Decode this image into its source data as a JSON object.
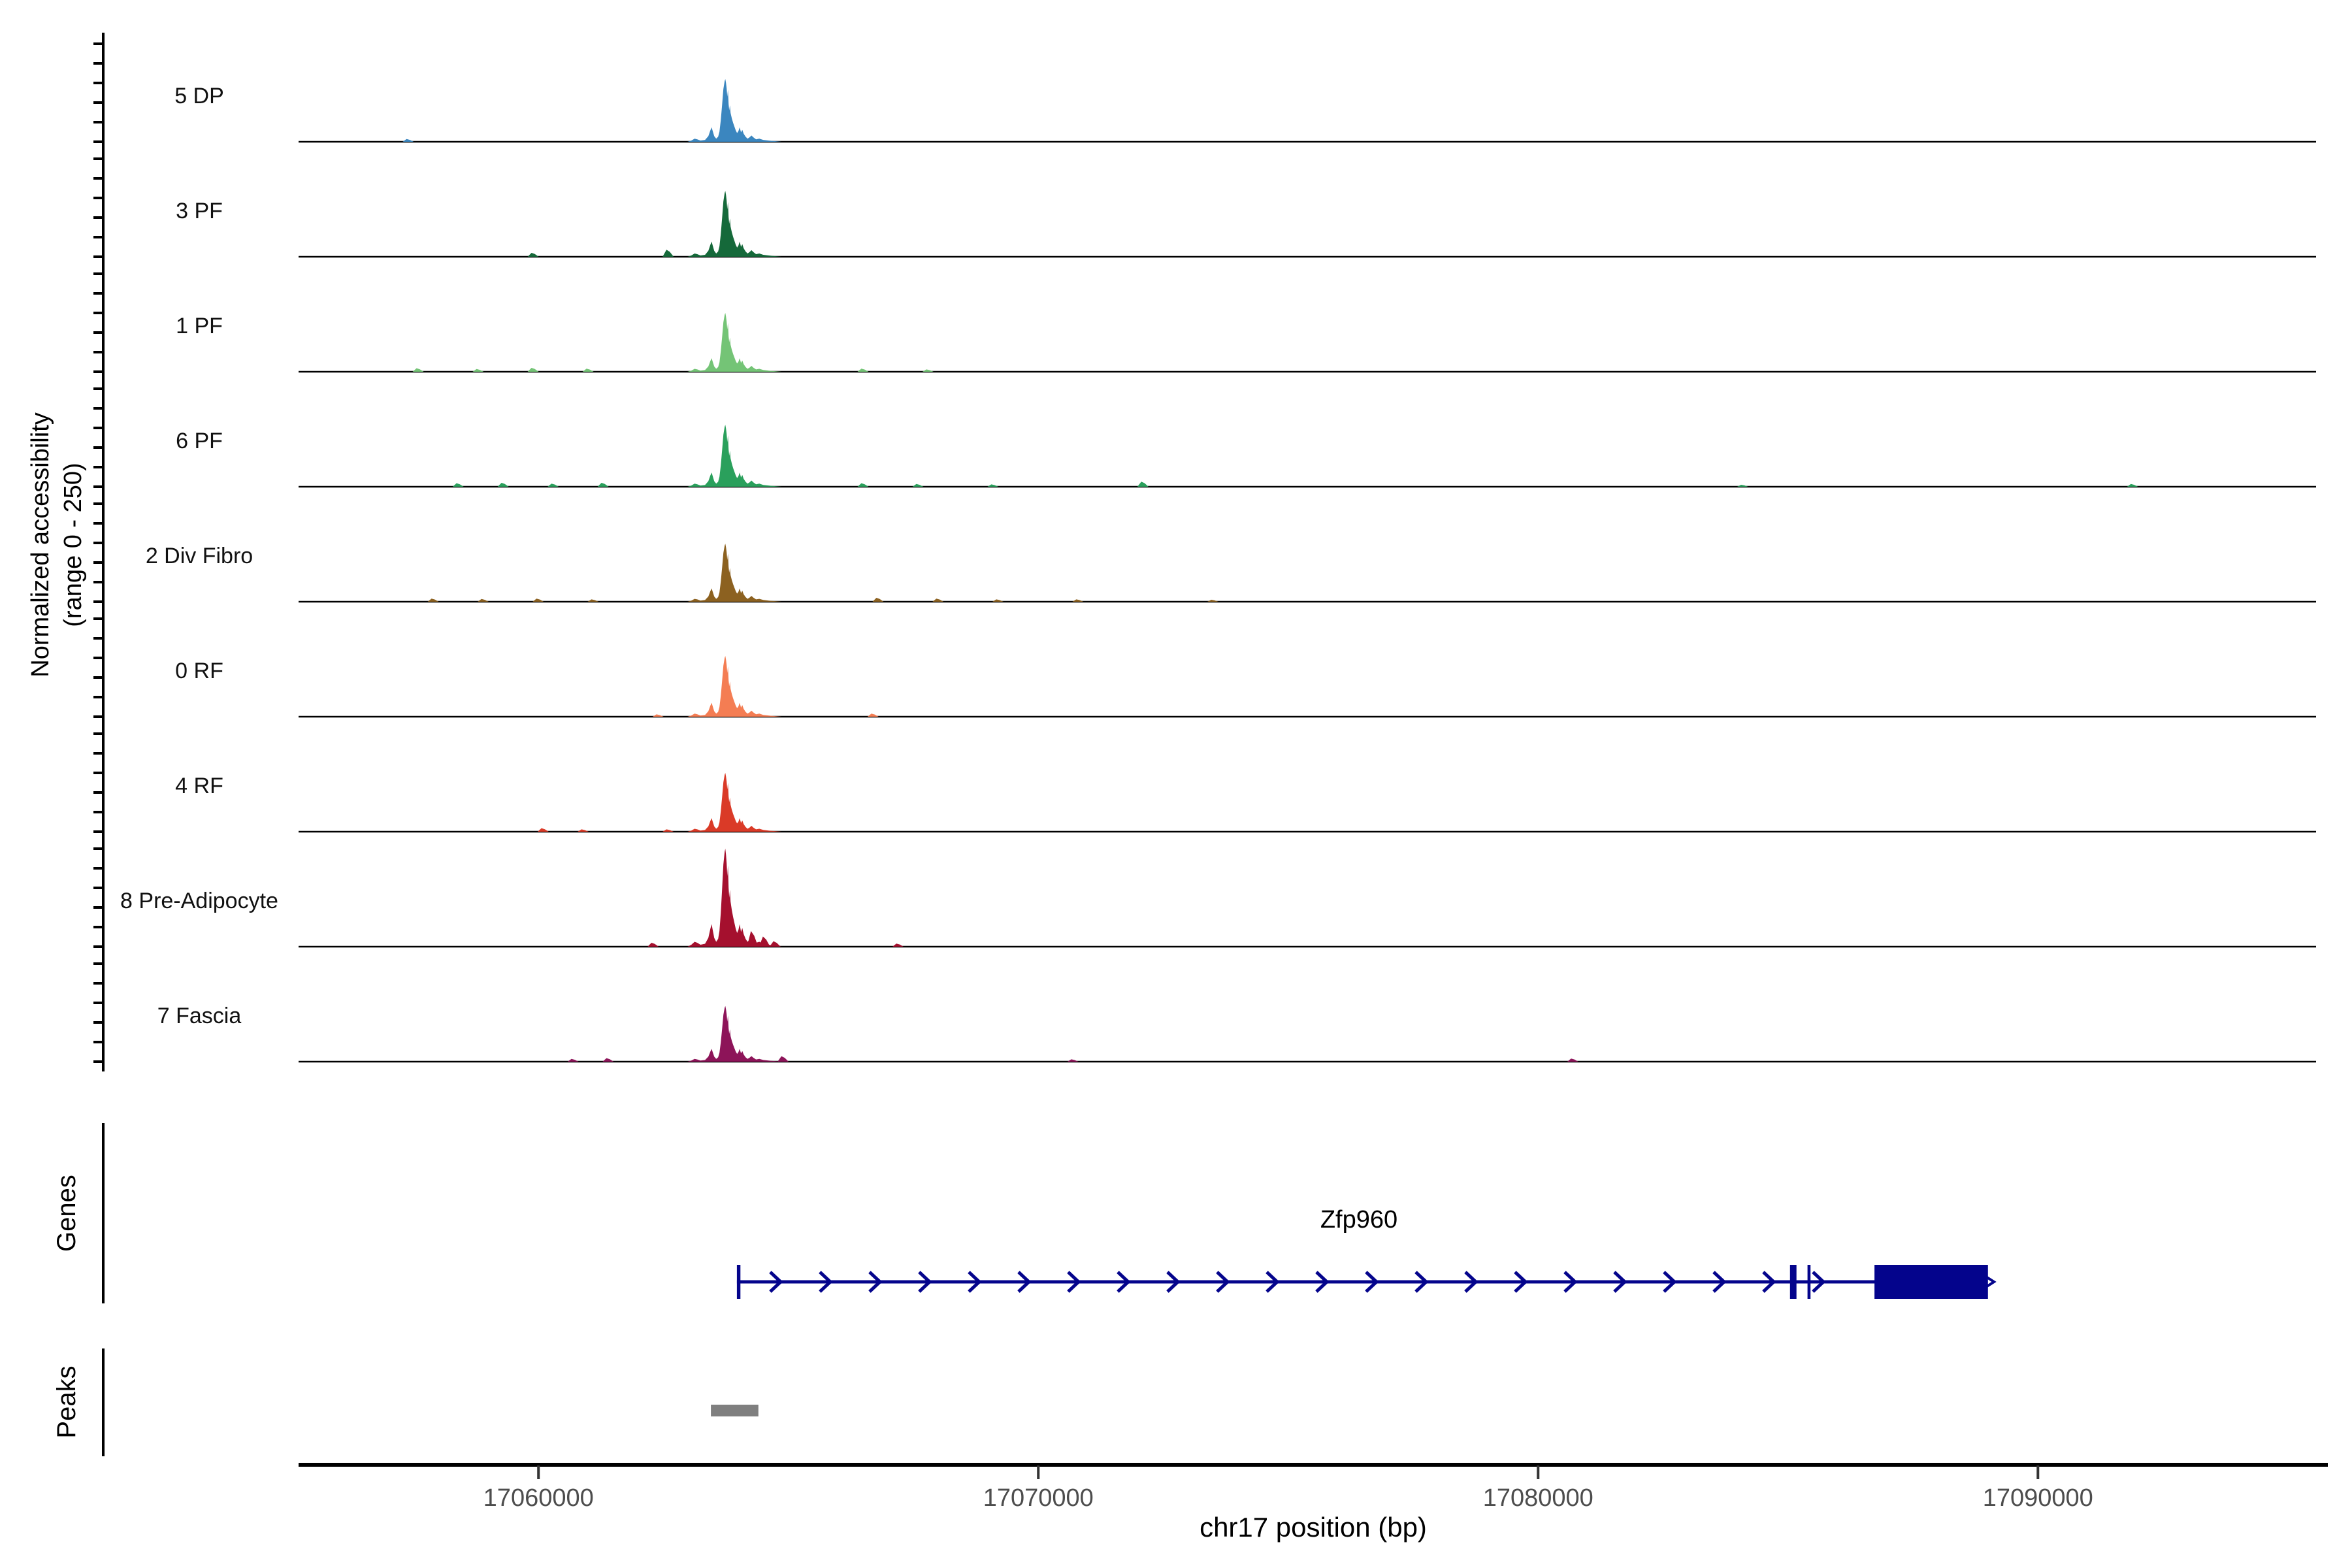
{
  "figure": {
    "y_axis_title": {
      "line1": "Normalized accessibility",
      "line2": "(range 0 - 250)"
    },
    "x_axis_title": "chr17 position (bp)",
    "sections": {
      "genes_label": "Genes",
      "peaks_label": "Peaks"
    },
    "gene_label": "Zfp960"
  },
  "chart_data": {
    "type": "area",
    "title": "",
    "description": "Genome-browser style normalized chromatin accessibility coverage tracks at the Zfp960 locus, with gene model and called peak",
    "region": {
      "chromosome": "chr17",
      "start": 17055200,
      "end": 17095800
    },
    "x_ticks": [
      17060000,
      17070000,
      17080000,
      17090000
    ],
    "xlabel": "chr17 position (bp)",
    "ylabel": "Normalized accessibility (range 0 - 250)",
    "ylim_per_track": [
      0,
      250
    ],
    "y_ticks_per_track": 6,
    "grid": false,
    "peak_summit_bp": 17063790,
    "tracks": [
      {
        "name": "5 DP",
        "color": "#3B86BF",
        "max_value": 160,
        "noise": [
          [
            17057400,
            7
          ]
        ]
      },
      {
        "name": "3 PF",
        "color": "#15693A",
        "max_value": 168,
        "noise": [
          [
            17059900,
            10
          ],
          [
            17062600,
            18
          ]
        ]
      },
      {
        "name": "1 PF",
        "color": "#74C476",
        "max_value": 150,
        "noise": [
          [
            17057600,
            9
          ],
          [
            17058800,
            7
          ],
          [
            17059900,
            10
          ],
          [
            17061000,
            8
          ],
          [
            17066500,
            8
          ],
          [
            17067800,
            6
          ]
        ]
      },
      {
        "name": "6 PF",
        "color": "#2AA05C",
        "max_value": 158,
        "noise": [
          [
            17058400,
            9
          ],
          [
            17059300,
            10
          ],
          [
            17060300,
            8
          ],
          [
            17061300,
            10
          ],
          [
            17066500,
            9
          ],
          [
            17067600,
            7
          ],
          [
            17069100,
            6
          ],
          [
            17072100,
            13
          ],
          [
            17084100,
            5
          ],
          [
            17091900,
            7
          ]
        ]
      },
      {
        "name": "2 Div Fibro",
        "color": "#8C6120",
        "max_value": 148,
        "noise": [
          [
            17057900,
            8
          ],
          [
            17058900,
            7
          ],
          [
            17060000,
            8
          ],
          [
            17061100,
            6
          ],
          [
            17066800,
            10
          ],
          [
            17068000,
            8
          ],
          [
            17069200,
            6
          ],
          [
            17070800,
            6
          ],
          [
            17073500,
            5
          ]
        ]
      },
      {
        "name": "0 RF",
        "color": "#F47D53",
        "max_value": 155,
        "noise": [
          [
            17062400,
            6
          ],
          [
            17066700,
            8
          ]
        ]
      },
      {
        "name": "4 RF",
        "color": "#DA3A27",
        "max_value": 150,
        "noise": [
          [
            17060100,
            9
          ],
          [
            17060900,
            6
          ],
          [
            17062600,
            6
          ]
        ]
      },
      {
        "name": "8 Pre-Adipocyte",
        "color": "#A5102E",
        "max_value": 250,
        "noise": [
          [
            17062300,
            10
          ],
          [
            17064290,
            40
          ],
          [
            17064530,
            26
          ],
          [
            17064740,
            14
          ],
          [
            17067200,
            8
          ]
        ]
      },
      {
        "name": "7 Fascia",
        "color": "#8D1459",
        "max_value": 142,
        "noise": [
          [
            17060700,
            7
          ],
          [
            17061400,
            9
          ],
          [
            17064900,
            14
          ],
          [
            17070700,
            6
          ],
          [
            17080700,
            8
          ]
        ]
      }
    ],
    "gene": {
      "name": "Zfp960",
      "strand": "+",
      "start": 17063970,
      "end": 17088990,
      "exons": [
        {
          "start": 17063970,
          "end": 17064040
        },
        {
          "start": 17085040,
          "end": 17085170
        },
        {
          "start": 17085390,
          "end": 17085450
        },
        {
          "start": 17086730,
          "end": 17089000
        }
      ],
      "color": "#04048C"
    },
    "peaks": [
      {
        "start": 17063450,
        "end": 17064400,
        "color": "#7F7F7F"
      }
    ]
  }
}
